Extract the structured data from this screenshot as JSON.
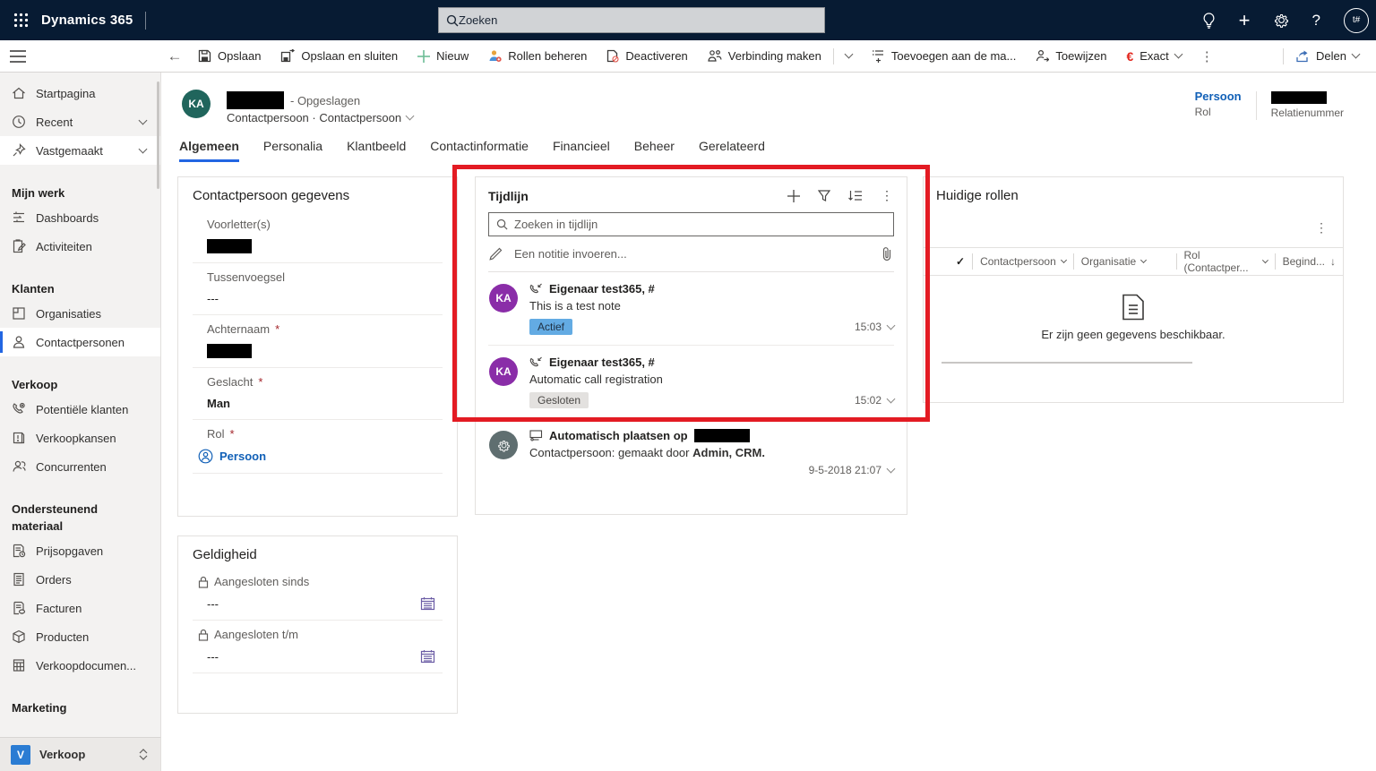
{
  "topbar": {
    "app_name": "Dynamics 365",
    "search_placeholder": "Zoeken",
    "account_badge": "t#"
  },
  "command_bar": {
    "items": {
      "save": "Opslaan",
      "save_close": "Opslaan en sluiten",
      "new": "Nieuw",
      "manage_roles": "Rollen beheren",
      "deactivate": "Deactiveren",
      "connect": "Verbinding maken",
      "add_to": "Toevoegen aan de ma...",
      "assign": "Toewijzen",
      "exact": "Exact",
      "share": "Delen"
    }
  },
  "sidebar": {
    "top_items": [
      {
        "label": "Startpagina"
      },
      {
        "label": "Recent"
      },
      {
        "label": "Vastgemaakt"
      }
    ],
    "sections": [
      {
        "title": "Mijn werk",
        "items": [
          {
            "label": "Dashboards"
          },
          {
            "label": "Activiteiten"
          }
        ]
      },
      {
        "title": "Klanten",
        "items": [
          {
            "label": "Organisaties"
          },
          {
            "label": "Contactpersonen"
          }
        ]
      },
      {
        "title": "Verkoop",
        "items": [
          {
            "label": "Potentiële klanten"
          },
          {
            "label": "Verkoopkansen"
          },
          {
            "label": "Concurrenten"
          }
        ]
      },
      {
        "title": "Ondersteunend materiaal",
        "items": [
          {
            "label": "Prijsopgaven"
          },
          {
            "label": "Orders"
          },
          {
            "label": "Facturen"
          },
          {
            "label": "Producten"
          },
          {
            "label": "Verkoopdocumen..."
          }
        ]
      },
      {
        "title": "Marketing",
        "items": []
      }
    ],
    "area_switcher": {
      "initial": "V",
      "label": "Verkoop"
    }
  },
  "record_header": {
    "avatar_initials": "KA",
    "saved_suffix": "- Opgeslagen",
    "entity_line": "Contactpersoon · Contactpersoon",
    "role_value": "Persoon",
    "role_label": "Rol",
    "relation_label": "Relatienummer"
  },
  "tabs": [
    {
      "label": "Algemeen"
    },
    {
      "label": "Personalia"
    },
    {
      "label": "Klantbeeld"
    },
    {
      "label": "Contactinformatie"
    },
    {
      "label": "Financieel"
    },
    {
      "label": "Beheer"
    },
    {
      "label": "Gerelateerd"
    }
  ],
  "marks": {
    "required": "*",
    "check": "✓",
    "sort_desc": "↓",
    "ellipsis": "⋮",
    "back": "←",
    "plus": "+",
    "help": "?",
    "dot_sep": "·"
  },
  "contact_card": {
    "title": "Contactpersoon gegevens",
    "fields": {
      "initials_label": "Voorletter(s)",
      "middle_label": "Tussenvoegsel",
      "middle_value": "---",
      "lastname_label": "Achternaam",
      "gender_label": "Geslacht",
      "gender_value": "Man",
      "role_label": "Rol",
      "role_value": "Persoon"
    }
  },
  "timeline_card": {
    "title": "Tijdlijn",
    "search_placeholder": "Zoeken in tijdlijn",
    "note_placeholder": "Een notitie invoeren...",
    "entries": [
      {
        "avatar": "KA",
        "title": "Eigenaar test365, #",
        "body": "This is a test note",
        "badge": "Actief",
        "time": "15:03"
      },
      {
        "avatar": "KA",
        "title": "Eigenaar test365, #",
        "body": "Automatic call registration",
        "badge": "Gesloten",
        "time": "15:02"
      },
      {
        "avatar": "system-gear",
        "title": "Automatisch plaatsen op",
        "body_prefix": "Contactpersoon: gemaakt door ",
        "body_bold": "Admin, CRM.",
        "time": "9-5-2018 21:07"
      }
    ]
  },
  "roles_card": {
    "title": "Huidige rollen",
    "columns": [
      {
        "label": "Contactpersoon"
      },
      {
        "label": "Organisatie"
      },
      {
        "label": "Rol (Contactper..."
      },
      {
        "label": "Begind..."
      }
    ],
    "empty_text": "Er zijn geen gegevens beschikbaar."
  },
  "validity_card": {
    "title": "Geldigheid",
    "since_label": "Aangesloten sinds",
    "since_value": "---",
    "until_label": "Aangesloten t/m",
    "until_value": "---"
  },
  "colors": {
    "accent": "#1160b7",
    "topbar": "#071b33",
    "red_box": "#e31b23",
    "badge_active": "#63abe3",
    "avatar_teal": "#20655c",
    "avatar_purple": "#8a2da8"
  }
}
